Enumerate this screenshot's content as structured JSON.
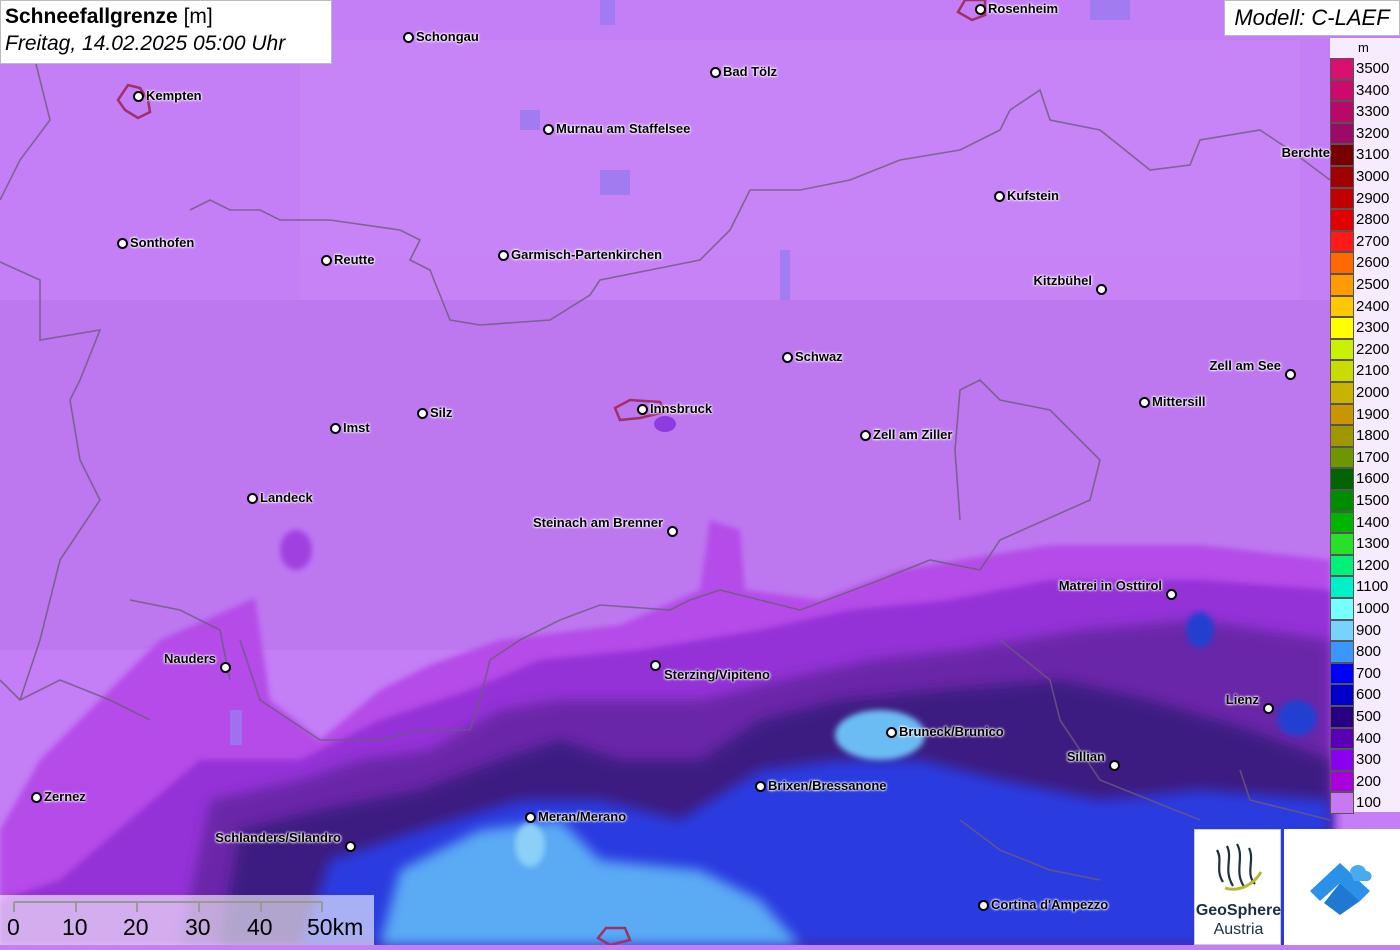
{
  "title": {
    "main": "Schneefallgrenze",
    "unit": "[m]",
    "datetime": "Freitag, 14.02.2025 05:00 Uhr"
  },
  "model_label": "Modell: C-LAEF",
  "legend": {
    "unit": "m",
    "entries": [
      {
        "label": "3500",
        "color": "#d8106e"
      },
      {
        "label": "3400",
        "color": "#cc0a6c"
      },
      {
        "label": "3300",
        "color": "#b8086a"
      },
      {
        "label": "3200",
        "color": "#9a0a66"
      },
      {
        "label": "3100",
        "color": "#780000"
      },
      {
        "label": "3000",
        "color": "#a00000"
      },
      {
        "label": "2900",
        "color": "#c00000"
      },
      {
        "label": "2800",
        "color": "#e00000"
      },
      {
        "label": "2700",
        "color": "#ff1a1a"
      },
      {
        "label": "2600",
        "color": "#ff6a00"
      },
      {
        "label": "2500",
        "color": "#ff9a00"
      },
      {
        "label": "2400",
        "color": "#ffc800"
      },
      {
        "label": "2300",
        "color": "#ffff00"
      },
      {
        "label": "2200",
        "color": "#c8f000"
      },
      {
        "label": "2100",
        "color": "#c8dc00"
      },
      {
        "label": "2000",
        "color": "#c8b400"
      },
      {
        "label": "1900",
        "color": "#c89600"
      },
      {
        "label": "1800",
        "color": "#a09600"
      },
      {
        "label": "1700",
        "color": "#6e9600"
      },
      {
        "label": "1600",
        "color": "#006400"
      },
      {
        "label": "1500",
        "color": "#008c00"
      },
      {
        "label": "1400",
        "color": "#00b400"
      },
      {
        "label": "1300",
        "color": "#28e028"
      },
      {
        "label": "1200",
        "color": "#00f078"
      },
      {
        "label": "1100",
        "color": "#00f0c8"
      },
      {
        "label": "1000",
        "color": "#78ffff"
      },
      {
        "label": "900",
        "color": "#78d2ff"
      },
      {
        "label": "800",
        "color": "#3c96ff"
      },
      {
        "label": "700",
        "color": "#0000ff"
      },
      {
        "label": "600",
        "color": "#0000c8"
      },
      {
        "label": "500",
        "color": "#280082"
      },
      {
        "label": "400",
        "color": "#5a00b4"
      },
      {
        "label": "300",
        "color": "#8c00f0"
      },
      {
        "label": "200",
        "color": "#aa00dc"
      },
      {
        "label": "100",
        "color": "#c878f0"
      }
    ]
  },
  "cities": [
    {
      "name": "Rosenheim"
    },
    {
      "name": "Schongau"
    },
    {
      "name": "Bad Tölz"
    },
    {
      "name": "Kempten"
    },
    {
      "name": "Murnau am Staffelsee"
    },
    {
      "name": "Berchte"
    },
    {
      "name": "Kufstein"
    },
    {
      "name": "Sonthofen"
    },
    {
      "name": "Reutte"
    },
    {
      "name": "Garmisch-Partenkirchen"
    },
    {
      "name": "Kitzbühel"
    },
    {
      "name": "Schwaz"
    },
    {
      "name": "Zell am See"
    },
    {
      "name": "Mittersill"
    },
    {
      "name": "Innsbruck"
    },
    {
      "name": "Silz"
    },
    {
      "name": "Imst"
    },
    {
      "name": "Zell am Ziller"
    },
    {
      "name": "Landeck"
    },
    {
      "name": "Steinach am Brenner"
    },
    {
      "name": "Matrei in Osttirol"
    },
    {
      "name": "Nauders"
    },
    {
      "name": "Sterzing/Vipiteno"
    },
    {
      "name": "Lienz"
    },
    {
      "name": "Bruneck/Brunico"
    },
    {
      "name": "Sillian"
    },
    {
      "name": "Brixen/Bressanone"
    },
    {
      "name": "Zernez"
    },
    {
      "name": "Meran/Merano"
    },
    {
      "name": "Schlanders/Silandro"
    },
    {
      "name": "Cortina d'Ampezzo"
    }
  ],
  "scale_bar": {
    "labels": [
      "0",
      "10",
      "20",
      "30",
      "40",
      "50km"
    ]
  },
  "logos": {
    "geosphere_line1": "GeoSphere",
    "geosphere_line2": "Austria"
  }
}
